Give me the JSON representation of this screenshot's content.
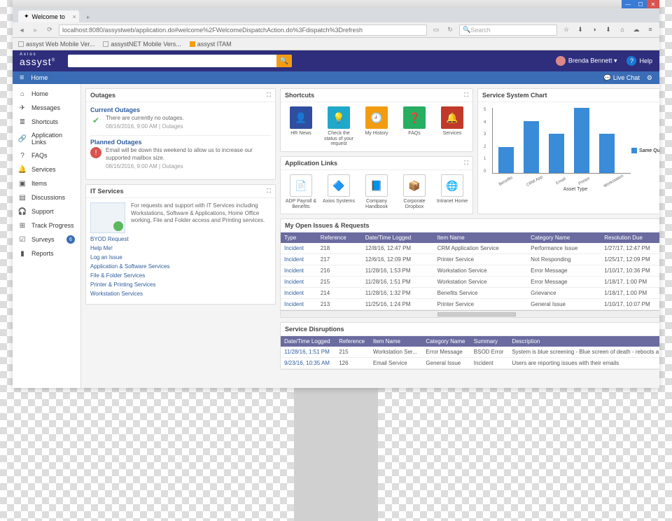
{
  "browser": {
    "tab_title": "Welcome to",
    "url": "localhost:8080/assystweb/application.do#welcome%2FWelcomeDispatchAction.do%3Fdispatch%3Drefresh",
    "search_placeholder": "Search",
    "bookmarks": [
      "assyst Web Mobile Ver...",
      "assystNET Mobile Vers...",
      "assyst ITAM"
    ]
  },
  "header": {
    "logo_top": "Axios",
    "logo": "assyst",
    "user": "Brenda Bennett",
    "help": "Help"
  },
  "breadcrumb": {
    "home": "Home",
    "chat": "Live Chat"
  },
  "sidebar": [
    {
      "icon": "⌂",
      "label": "Home"
    },
    {
      "icon": "✈",
      "label": "Messages"
    },
    {
      "icon": "≣",
      "label": "Shortcuts"
    },
    {
      "icon": "🔗",
      "label": "Application Links"
    },
    {
      "icon": "?",
      "label": "FAQs"
    },
    {
      "icon": "🔔",
      "label": "Services"
    },
    {
      "icon": "▣",
      "label": "Items"
    },
    {
      "icon": "▤",
      "label": "Discussions"
    },
    {
      "icon": "🎧",
      "label": "Support"
    },
    {
      "icon": "⊞",
      "label": "Track Progress"
    },
    {
      "icon": "☑",
      "label": "Surveys",
      "badge": "6"
    },
    {
      "icon": "▮",
      "label": "Reports"
    }
  ],
  "outages": {
    "title": "Outages",
    "current": {
      "h": "Current Outages",
      "text": "There are currently no outages.",
      "meta": "08/16/2016, 9:00 AM  |  Outages"
    },
    "planned": {
      "h": "Planned Outages",
      "text": "Email will be down this weekend to allow us to increase our supported mailbox size.",
      "meta": "08/16/2016, 9:00 AM  |  Outages"
    }
  },
  "itservices": {
    "title": "IT Services",
    "desc": "For requests and support with IT Services including Workstations, Software & Applications, Home Office working, File and Folder access and Printing services.",
    "links": [
      "BYOD Request",
      "Help Me!",
      "Log an Issue",
      "Application & Software Services",
      "File & Folder Services",
      "Printer & Printing Services",
      "Workstation Services"
    ]
  },
  "shortcuts": {
    "title": "Shortcuts",
    "tiles": [
      {
        "color": "#2f4ea0",
        "icon": "👤",
        "label": "HR News"
      },
      {
        "color": "#1fa8c9",
        "icon": "💡",
        "label": "Check the status of your request"
      },
      {
        "color": "#f39c12",
        "icon": "🕘",
        "label": "My History"
      },
      {
        "color": "#27ae60",
        "icon": "❓",
        "label": "FAQs"
      },
      {
        "color": "#c0392b",
        "icon": "🔔",
        "label": "Services"
      }
    ]
  },
  "applinks": {
    "title": "Application Links",
    "tiles": [
      {
        "icon": "📄",
        "label": "ADP Payroll & Benefits"
      },
      {
        "icon": "🔷",
        "label": "Axios Systems"
      },
      {
        "icon": "📘",
        "label": "Company Handbook"
      },
      {
        "icon": "📦",
        "label": "Corporate Dropbox"
      },
      {
        "icon": "🌐",
        "label": "Intranet Home"
      }
    ]
  },
  "chartpanel": {
    "title": "Service System Chart"
  },
  "chart_data": {
    "type": "bar",
    "categories": [
      "Benefits",
      "CRM App",
      "Email",
      "Printer",
      "Workstation"
    ],
    "values": [
      2,
      4,
      3,
      5,
      3
    ],
    "xlabel": "Asset Type",
    "ylabel": "",
    "ylim": [
      0,
      5
    ],
    "legend": "Same Quarter"
  },
  "issues": {
    "title": "My Open Issues & Requests",
    "cols": [
      "Type",
      "Reference",
      "Date/Time Logged",
      "Item Name",
      "Category Name",
      "Resolution Due"
    ],
    "rows": [
      [
        "Incident",
        "218",
        "12/8/16, 12:47 PM",
        "CRM Application Service",
        "Performance Issue",
        "1/27/17, 12:47 PM"
      ],
      [
        "Incident",
        "217",
        "12/6/16, 12:09 PM",
        "Printer Service",
        "Not Responding",
        "1/25/17, 12:09 PM"
      ],
      [
        "Incident",
        "216",
        "11/28/16, 1:53 PM",
        "Workstation Service",
        "Error Message",
        "1/10/17, 10:36 PM"
      ],
      [
        "Incident",
        "215",
        "11/28/16, 1:51 PM",
        "Workstation Service",
        "Error Message",
        "1/18/17, 1:00 PM"
      ],
      [
        "Incident",
        "214",
        "11/28/16, 1:32 PM",
        "Benefits Service",
        "Grievance",
        "1/18/17, 1:00 PM"
      ],
      [
        "Incident",
        "213",
        "11/25/16, 1:24 PM",
        "Printer Service",
        "General Issue",
        "1/10/17, 10:07 PM"
      ]
    ]
  },
  "disruptions": {
    "title": "Service Disruptions",
    "cols": [
      "Date/Time Logged",
      "Reference",
      "Item Name",
      "Category Name",
      "Summary",
      "Description"
    ],
    "rows": [
      [
        "11/28/16, 1:51 PM",
        "215",
        "Workstation Ser...",
        "Error Message",
        "BSOD Error",
        "System is blue screening - Blue screen of death - reboots a..."
      ],
      [
        "9/23/16, 10:35 AM",
        "126",
        "Email Service",
        "General Issue",
        "Incident",
        "Users are reporting issues with their emails"
      ]
    ]
  }
}
